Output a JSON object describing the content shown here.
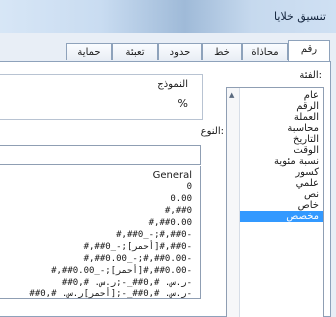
{
  "dialog": {
    "title": "تنسيق خلايا"
  },
  "tabs": [
    {
      "label": "رقم",
      "active": true
    },
    {
      "label": "محاذاة",
      "active": false
    },
    {
      "label": "خط",
      "active": false
    },
    {
      "label": "حدود",
      "active": false
    },
    {
      "label": "تعبئة",
      "active": false
    },
    {
      "label": "حماية",
      "active": false
    }
  ],
  "category": {
    "label": "الفئة:",
    "items": [
      "عام",
      "الرقم",
      "العملة",
      "محاسبة",
      "التاريخ",
      "الوقت",
      "نسبة مئوية",
      "كسور",
      "علمي",
      "نص",
      "خاص",
      "مخصص"
    ],
    "selected_index": 11
  },
  "sample": {
    "label": "النموذج",
    "value": "%"
  },
  "type": {
    "label": "النوع:",
    "value": "",
    "formats": [
      "General",
      "0",
      "0.00",
      "#,##0",
      "#,##0.00",
      "#,##0_-;#,##0-",
      "#,##0_-;[أحمر]#,##0-",
      "#,##0.00_-;#,##0.00-",
      "#,##0.00_-;[أحمر]#,##0.00-",
      "ر.س.‏ #,##0_-;ر.س.‏ #,##0-",
      "ر.س.‏ #,##0_-;[أحمر]ر.س.‏ #,##0-"
    ]
  },
  "colors": {
    "selection": "#3399ff",
    "border": "#8ea2bb"
  }
}
